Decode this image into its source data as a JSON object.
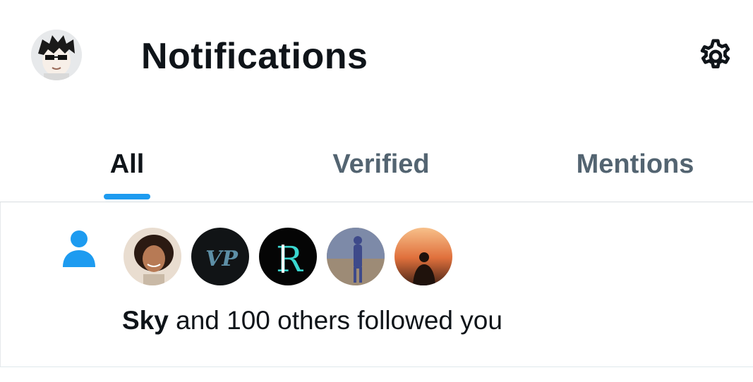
{
  "header": {
    "title": "Notifications",
    "avatar_icon": "profile-avatar-cartoon",
    "settings_icon": "gear-icon"
  },
  "tabs": [
    {
      "label": "All",
      "active": true
    },
    {
      "label": "Verified",
      "active": false
    },
    {
      "label": "Mentions",
      "active": false
    }
  ],
  "notifications": [
    {
      "icon": "person-icon",
      "avatars": [
        "woman-portrait",
        "vp-logo",
        "r-logo",
        "person-silhouette",
        "sunset-person"
      ],
      "actor": "Sky",
      "text": " and 100 others followed you"
    }
  ],
  "colors": {
    "accent": "#1d9bf0",
    "text_primary": "#0f1419",
    "text_secondary": "#536471"
  }
}
